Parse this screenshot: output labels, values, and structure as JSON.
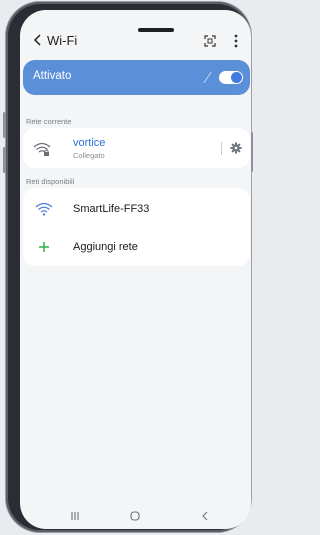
{
  "header": {
    "title": "Wi-Fi"
  },
  "toggle": {
    "label": "Attivato",
    "on": true
  },
  "current_section": {
    "label": "Rete corrente"
  },
  "current_network": {
    "name": "vortice",
    "status": "Collegato"
  },
  "available_section": {
    "label": "Reti disponibili"
  },
  "available_networks": [
    {
      "name": "SmartLife-FF33"
    }
  ],
  "add_network": {
    "label": "Aggiungi rete"
  },
  "colors": {
    "accent": "#5b8fd8",
    "network_name_active": "#2e6fd6",
    "add_icon": "#2fb34a"
  },
  "icons": [
    "back-icon",
    "qr-scan-icon",
    "more-options-icon",
    "wifi-lock-icon",
    "gear-icon",
    "wifi-icon",
    "plus-icon",
    "recent-apps-icon",
    "home-icon",
    "nav-back-icon"
  ]
}
